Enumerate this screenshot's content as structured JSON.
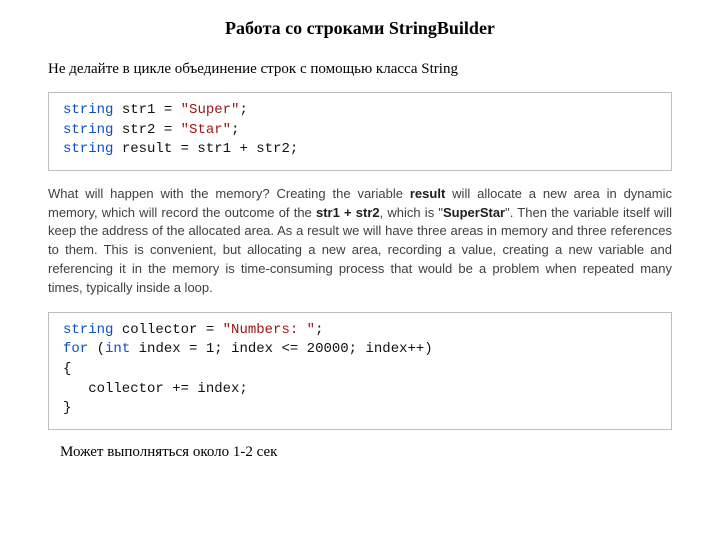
{
  "title": "Работа со строками StringBuilder",
  "intro": "Не делайте в цикле объединение строк с помощью класса String",
  "code1": {
    "l1": {
      "type": "string",
      "var": " str1 = ",
      "str": "\"Super\"",
      "end": ";"
    },
    "l2": {
      "type": "string",
      "var": " str2 = ",
      "str": "\"Star\"",
      "end": ";"
    },
    "l3": {
      "type": "string",
      "rest": " result = str1 + str2;"
    }
  },
  "explain": {
    "p1a": "What will happen with the memory? Creating the variable ",
    "p1b": "result",
    "p1c": " will allocate a new area in dynamic memory, which will record the outcome of the ",
    "p1d": "str1 + str2",
    "p1e": ", which is \"",
    "p1f": "SuperStar",
    "p1g": "\". Then the variable itself will keep the address of the allocated area. As a result we will have three areas in memory and three references to them. This is convenient, but allocating a new area, recording a value, creating a new variable and referencing it in the memory is time-consuming process that would be a problem when repeated many times, typically inside a loop."
  },
  "code2": {
    "l1": {
      "type": "string",
      "var": " collector = ",
      "str": "\"Numbers: \"",
      "end": ";"
    },
    "l2": {
      "kw1": "for",
      "p1": " (",
      "kw2": "int",
      "p2": " index = 1; index <= 20000; index++)"
    },
    "l3": "{",
    "l4": "   collector += index;",
    "l5": "}"
  },
  "footnote": "Может выполняться около 1-2 сек"
}
